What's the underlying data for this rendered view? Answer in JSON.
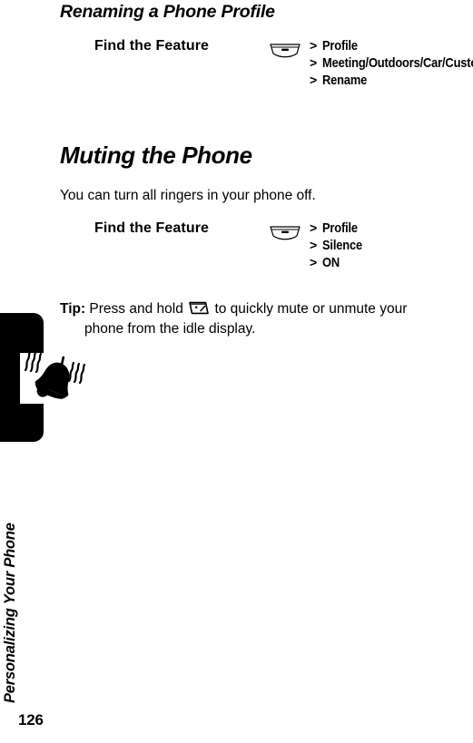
{
  "page": {
    "number": "126",
    "chapter_title": "Personalizing Your Phone",
    "chapter_icon": "ringing-bell-icon"
  },
  "sections": [
    {
      "heading": "Renaming a Phone Profile",
      "heading_style": "minor",
      "find_the_feature": {
        "label": "Find the Feature",
        "key_icon": "menu-soft-key-icon",
        "steps": [
          {
            "separator": ">",
            "text": "Profile"
          },
          {
            "separator": ">",
            "text": "Meeting/Outdoors/Car/Customized/Office"
          },
          {
            "separator": ">",
            "text": "Rename"
          }
        ]
      }
    },
    {
      "heading": "Muting the Phone",
      "heading_style": "major",
      "intro": "You can turn all ringers in your phone off.",
      "find_the_feature": {
        "label": "Find the Feature",
        "key_icon": "menu-soft-key-icon",
        "steps": [
          {
            "separator": ">",
            "text": "Profile"
          },
          {
            "separator": ">",
            "text": "Silence"
          },
          {
            "separator": ">",
            "text": "ON"
          }
        ]
      }
    }
  ],
  "tip": {
    "label": "Tip:",
    "text_before_icon": " Press and hold ",
    "icon": "star-key-icon",
    "text_after_icon": " to quickly mute or unmute your",
    "line2": "phone from the idle display."
  },
  "colors": {
    "ink": "#000000",
    "paper": "#ffffff",
    "tab": "#000000"
  }
}
